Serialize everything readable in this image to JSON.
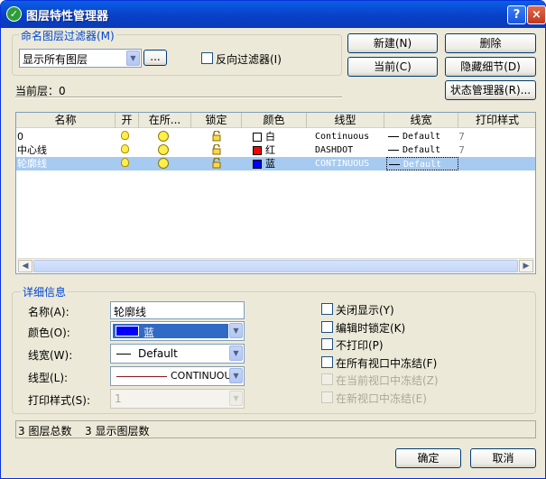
{
  "window": {
    "title": "图层特性管理器",
    "app_icon": "autocad-icon",
    "help": "?",
    "close": "×"
  },
  "filter_group": {
    "label": "命名图层过滤器(M)",
    "select_value": "显示所有图层",
    "browse_label": "...",
    "invert_label": "反向过滤器(I)",
    "invert_checked": false
  },
  "buttons": {
    "new": "新建(N)",
    "delete": "删除",
    "current": "当前(C)",
    "hide_details": "隐藏细节(D)",
    "state_manager": "状态管理器(R)...",
    "ok": "确定",
    "cancel": "取消"
  },
  "current_layer": "当前层：0",
  "table": {
    "columns": [
      "名称",
      "开",
      "在所...",
      "锁定",
      "颜色",
      "线型",
      "线宽",
      "打印样式"
    ],
    "rows": [
      {
        "name": "0",
        "color_name": "白",
        "color_hex": "#ffffff",
        "linetype": "Continuous",
        "lineweight": "Default",
        "plot_style": "7",
        "selected": false
      },
      {
        "name": "中心线",
        "color_name": "红",
        "color_hex": "#ff0000",
        "linetype": "DASHDOT",
        "lineweight": "Default",
        "plot_style": "7",
        "selected": false
      },
      {
        "name": "轮廓线",
        "color_name": "蓝",
        "color_hex": "#0000ff",
        "linetype": "CONTINUOUS",
        "lineweight": "Default",
        "plot_style": "",
        "selected": true
      }
    ]
  },
  "details": {
    "label": "详细信息",
    "name_label": "名称(A):",
    "name_value": "轮廓线",
    "color_label": "颜色(O):",
    "color_value": "蓝",
    "color_hex": "#0000ff",
    "lineweight_label": "线宽(W):",
    "lineweight_value": "Default",
    "linetype_label": "线型(L):",
    "linetype_value": "CONTINUOU",
    "plotstyle_label": "打印样式(S):",
    "plotstyle_value": "1",
    "checks": [
      {
        "label": "关闭显示(Y)",
        "enabled": true
      },
      {
        "label": "编辑时锁定(K)",
        "enabled": true
      },
      {
        "label": "不打印(P)",
        "enabled": true
      },
      {
        "label": "在所有视口中冻结(F)",
        "enabled": true
      },
      {
        "label": "在当前视口中冻结(Z)",
        "enabled": false
      },
      {
        "label": "在新视口中冻结(E)",
        "enabled": false
      }
    ]
  },
  "status": {
    "total": "3 图层总数",
    "shown": "3 显示图层数"
  }
}
